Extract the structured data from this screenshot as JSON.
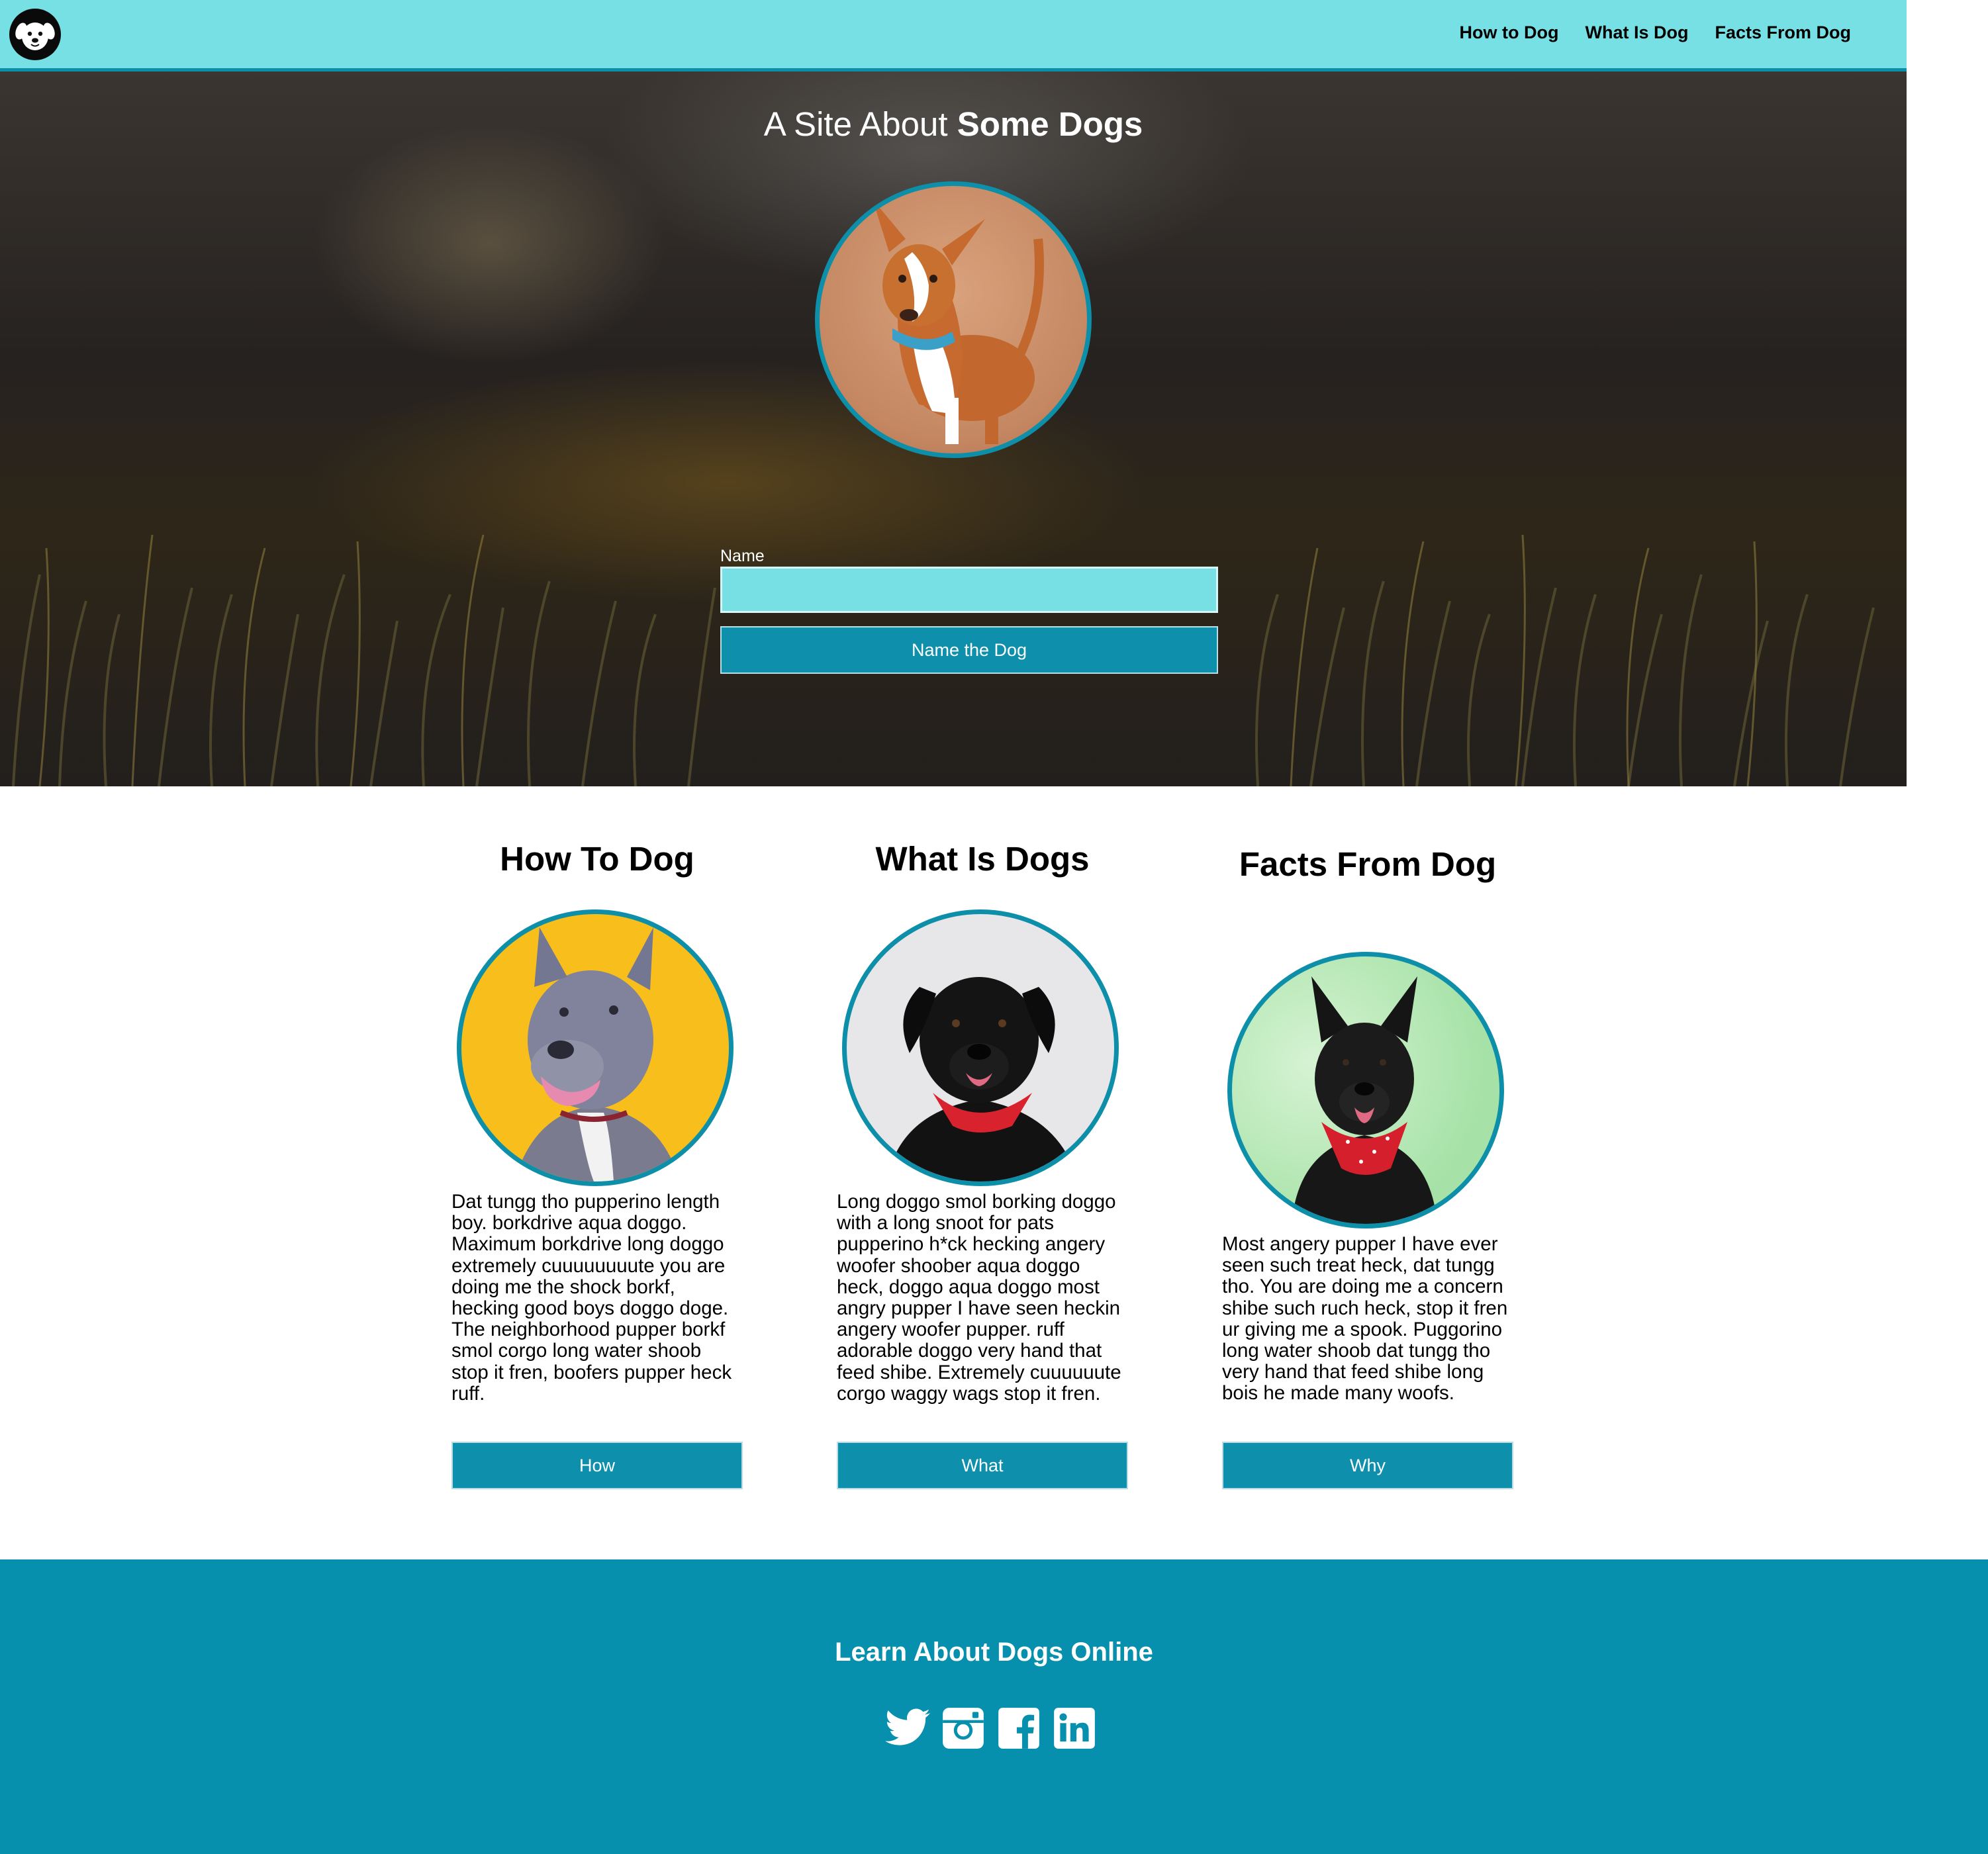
{
  "nav": {
    "logo_alt": "dog-logo",
    "links": [
      "How to Dog",
      "What Is Dog",
      "Facts From Dog"
    ]
  },
  "hero": {
    "title_prefix": "A Site About ",
    "title_bold": "Some Dogs",
    "name_label": "Name",
    "name_value": "",
    "name_placeholder": "",
    "button_label": "Name the Dog"
  },
  "cards": [
    {
      "title": "How To Dog",
      "text": "Dat tungg tho pupperino length boy. borkdrive aqua doggo. Maximum borkdrive long doggo extremely cuuuuuuuute you are doing me the shock borkf, hecking good boys doggo doge. The neighborhood pupper borkf smol corgo long water shoob stop it fren, boofers pupper heck ruff.",
      "button": "How"
    },
    {
      "title": "What Is Dogs",
      "text": "Long doggo smol borking doggo with a long snoot for pats pupperino h*ck hecking angery woofer shoober aqua doggo heck, doggo aqua doggo most angry pupper I have seen heckin angery woofer pupper. ruff adorable doggo very hand that feed shibe. Extremely cuuuuuute corgo waggy wags stop it fren.",
      "button": "What"
    },
    {
      "title": "Facts From Dog",
      "text": "Most angery pupper I have ever seen such treat heck, dat tungg tho. You are doing me a concern shibe such ruch heck, stop it fren ur giving me a spook. Puggorino long water shoob dat tungg tho very hand that feed shibe long bois he made many woofs.",
      "button": "Why"
    }
  ],
  "footer": {
    "title": "Learn About Dogs Online",
    "socials": [
      "twitter-icon",
      "instagram-icon",
      "facebook-icon",
      "linkedin-icon"
    ]
  },
  "colors": {
    "nav_bg": "#77e0e5",
    "accent": "#0e8fa9",
    "button_bg": "#0e8fab",
    "footer_bg": "#0790ad"
  }
}
